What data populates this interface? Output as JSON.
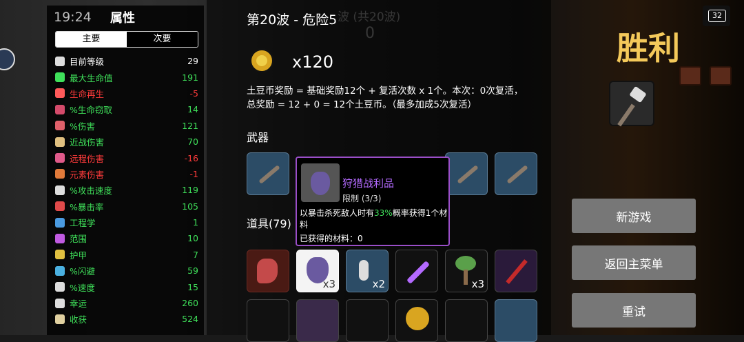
{
  "status": {
    "time": "19:24",
    "battery": "32"
  },
  "stats_panel": {
    "title": "属性",
    "tabs": [
      {
        "label": "主要"
      },
      {
        "label": "次要"
      }
    ],
    "rows": [
      {
        "label": "目前等级",
        "value": "29",
        "color": "white"
      },
      {
        "label": "最大生命值",
        "value": "191",
        "color": "green"
      },
      {
        "label": "生命再生",
        "value": "-5",
        "color": "red"
      },
      {
        "label": "%生命窃取",
        "value": "14",
        "color": "green"
      },
      {
        "label": "%伤害",
        "value": "121",
        "color": "green"
      },
      {
        "label": "近战伤害",
        "value": "70",
        "color": "green"
      },
      {
        "label": "远程伤害",
        "value": "-16",
        "color": "red"
      },
      {
        "label": "元素伤害",
        "value": "-1",
        "color": "red"
      },
      {
        "label": "%攻击速度",
        "value": "119",
        "color": "green"
      },
      {
        "label": "%暴击率",
        "value": "105",
        "color": "green"
      },
      {
        "label": "工程学",
        "value": "1",
        "color": "green"
      },
      {
        "label": "范围",
        "value": "10",
        "color": "green"
      },
      {
        "label": "护甲",
        "value": "7",
        "color": "green"
      },
      {
        "label": "%闪避",
        "value": "59",
        "color": "green"
      },
      {
        "label": "%速度",
        "value": "15",
        "color": "green"
      },
      {
        "label": "幸运",
        "value": "260",
        "color": "green"
      },
      {
        "label": "收获",
        "value": "524",
        "color": "green"
      }
    ]
  },
  "main": {
    "wave_title": "第20波 - 危险5",
    "bg_wave": "波 (共20波)",
    "bg_zero": "0",
    "coin_count": "x120",
    "reward_line1": "土豆币奖励 = 基础奖励12个 + 复活次数 x 1个。本次：0次复活，",
    "reward_line2": "总奖励 = 12 + 0 = 12个土豆币。（最多加成5次复活）",
    "weapons_label": "武器",
    "items_label": "道具(79)",
    "items_qty": [
      "x3",
      "x2",
      "x3"
    ]
  },
  "tooltip": {
    "title": "狩猎战利品",
    "subtitle": "限制 (3/3)",
    "desc_pre": "以暴击杀死敌人时有",
    "desc_pct": "33%",
    "desc_post": "概率获得1个材料",
    "obtained": "已获得的材料：0"
  },
  "result": {
    "title": "胜利",
    "buttons": {
      "new_game": "新游戏",
      "main_menu": "返回主菜单",
      "retry": "重试"
    }
  }
}
